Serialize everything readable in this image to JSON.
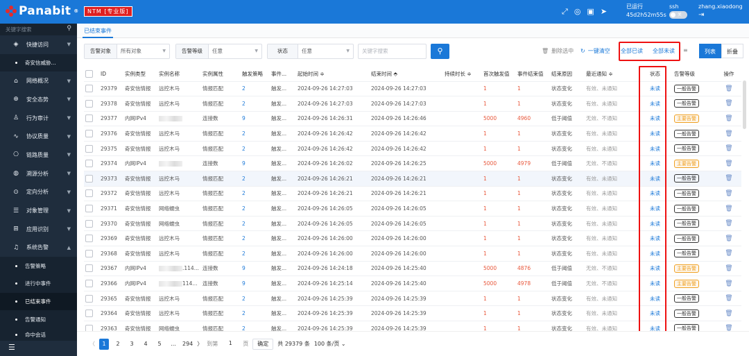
{
  "topbar": {
    "brand": "Panabit",
    "brand_reg": "®",
    "edition": "NTM [专业版]",
    "uptime_label": "已运行",
    "uptime_value": "45d2h52m55s",
    "ssh_label": "ssh",
    "toggle_text": "关",
    "user": "zhang.xiaodong",
    "logout_icon": "logout-icon"
  },
  "sidebar": {
    "search_placeholder": "关键字搜索",
    "items": [
      {
        "label": "快捷访问",
        "icon": "◈"
      },
      {
        "label": "奇安信威胁...",
        "sub": true
      },
      {
        "label": "网络概况",
        "icon": "⌂"
      },
      {
        "label": "安全态势",
        "icon": "⊕"
      },
      {
        "label": "行为审计",
        "icon": "♙"
      },
      {
        "label": "协议质量",
        "icon": "∿"
      },
      {
        "label": "链路质量",
        "icon": "⎔"
      },
      {
        "label": "溯源分析",
        "icon": "◍"
      },
      {
        "label": "定向分析",
        "icon": "⊙"
      },
      {
        "label": "对象管理",
        "icon": "☰"
      },
      {
        "label": "应用识别",
        "icon": "⊞"
      },
      {
        "label": "系统告警",
        "icon": "♫"
      }
    ],
    "subs": [
      "告警策略",
      "进行中事件",
      "已结束事件",
      "告警通知",
      "命中会话"
    ]
  },
  "tabs": {
    "current": "已结束事件"
  },
  "filters": {
    "target_label": "告警对象",
    "target_value": "所有对象",
    "level_label": "告警等级",
    "level_value": "任意",
    "status_label": "状态",
    "status_value": "任意",
    "keyword_placeholder": "关键字搜索",
    "delete_selected": "删除选中",
    "clear_all": "一键清空",
    "all_read": "全部已读",
    "all_unread": "全部未读",
    "view_list": "列表",
    "view_fold": "折叠"
  },
  "table": {
    "headers": [
      "ID",
      "实例类型",
      "实例名称",
      "实例属性",
      "触发策略",
      "事件...",
      "起始时间 ≑",
      "结束时间 ⬘",
      "持续时长 ≑",
      "首次触发值",
      "事件结束值",
      "结束原因",
      "最近通知 ≑",
      "状态",
      "告警等级",
      "操作"
    ],
    "rows": [
      [
        "29379",
        "奇安信情报",
        "远控木马",
        "情报匹配",
        "2",
        "触发...",
        "2024-09-26 14:27:03",
        "2024-09-26 14:27:03",
        "",
        "1",
        "1",
        "状态变化",
        "有效、未通知",
        "未读",
        "一般告警"
      ],
      [
        "29378",
        "奇安信情报",
        "远控木马",
        "情报匹配",
        "2",
        "触发...",
        "2024-09-26 14:27:03",
        "2024-09-26 14:27:03",
        "",
        "1",
        "1",
        "状态变化",
        "有效、未通知",
        "未读",
        "一般告警"
      ],
      [
        "29377",
        "内网IPv4",
        "",
        "连接数",
        "9",
        "触发...",
        "2024-09-26 14:26:31",
        "2024-09-26 14:26:46",
        "",
        "5000",
        "4960",
        "低于阈值",
        "无效、不通知",
        "未读",
        "主要告警"
      ],
      [
        "29376",
        "奇安信情报",
        "远控木马",
        "情报匹配",
        "2",
        "触发...",
        "2024-09-26 14:26:42",
        "2024-09-26 14:26:42",
        "",
        "1",
        "1",
        "状态变化",
        "有效、未通知",
        "未读",
        "一般告警"
      ],
      [
        "29375",
        "奇安信情报",
        "远控木马",
        "情报匹配",
        "2",
        "触发...",
        "2024-09-26 14:26:42",
        "2024-09-26 14:26:42",
        "",
        "1",
        "1",
        "状态变化",
        "有效、未通知",
        "未读",
        "一般告警"
      ],
      [
        "29374",
        "内网IPv4",
        "",
        "连接数",
        "9",
        "触发...",
        "2024-09-26 14:26:02",
        "2024-09-26 14:26:25",
        "",
        "5000",
        "4979",
        "低于阈值",
        "无效、不通知",
        "未读",
        "主要告警"
      ],
      [
        "29373",
        "奇安信情报",
        "远控木马",
        "情报匹配",
        "2",
        "触发...",
        "2024-09-26 14:26:21",
        "2024-09-26 14:26:21",
        "",
        "1",
        "1",
        "状态变化",
        "有效、未通知",
        "未读",
        "一般告警"
      ],
      [
        "29372",
        "奇安信情报",
        "远控木马",
        "情报匹配",
        "2",
        "触发...",
        "2024-09-26 14:26:21",
        "2024-09-26 14:26:21",
        "",
        "1",
        "1",
        "状态变化",
        "有效、未通知",
        "未读",
        "一般告警"
      ],
      [
        "29371",
        "奇安信情报",
        "网络蠕虫",
        "情报匹配",
        "2",
        "触发...",
        "2024-09-26 14:26:05",
        "2024-09-26 14:26:05",
        "",
        "1",
        "1",
        "状态变化",
        "有效、未通知",
        "未读",
        "一般告警"
      ],
      [
        "29370",
        "奇安信情报",
        "网络蠕虫",
        "情报匹配",
        "2",
        "触发...",
        "2024-09-26 14:26:05",
        "2024-09-26 14:26:05",
        "",
        "1",
        "1",
        "状态变化",
        "有效、未通知",
        "未读",
        "一般告警"
      ],
      [
        "29369",
        "奇安信情报",
        "远控木马",
        "情报匹配",
        "2",
        "触发...",
        "2024-09-26 14:26:00",
        "2024-09-26 14:26:00",
        "",
        "1",
        "1",
        "状态变化",
        "有效、未通知",
        "未读",
        "一般告警"
      ],
      [
        "29368",
        "奇安信情报",
        "远控木马",
        "情报匹配",
        "2",
        "触发...",
        "2024-09-26 14:26:00",
        "2024-09-26 14:26:00",
        "",
        "1",
        "1",
        "状态变化",
        "有效、未通知",
        "未读",
        "一般告警"
      ],
      [
        "29367",
        "内网IPv4",
        ".114...",
        "连接数",
        "9",
        "触发...",
        "2024-09-26 14:24:18",
        "2024-09-26 14:25:40",
        "",
        "5000",
        "4876",
        "低于阈值",
        "无效、不通知",
        "未读",
        "主要告警"
      ],
      [
        "29366",
        "内网IPv4",
        "114...",
        "连接数",
        "9",
        "触发...",
        "2024-09-26 14:25:14",
        "2024-09-26 14:25:40",
        "",
        "5000",
        "4978",
        "低于阈值",
        "无效、不通知",
        "未读",
        "主要告警"
      ],
      [
        "29365",
        "奇安信情报",
        "远控木马",
        "情报匹配",
        "2",
        "触发...",
        "2024-09-26 14:25:39",
        "2024-09-26 14:25:39",
        "",
        "1",
        "1",
        "状态变化",
        "有效、未通知",
        "未读",
        "一般告警"
      ],
      [
        "29364",
        "奇安信情报",
        "远控木马",
        "情报匹配",
        "2",
        "触发...",
        "2024-09-26 14:25:39",
        "2024-09-26 14:25:39",
        "",
        "1",
        "1",
        "状态变化",
        "有效、未通知",
        "未读",
        "一般告警"
      ],
      [
        "29363",
        "奇安信情报",
        "网络蠕虫",
        "情报匹配",
        "2",
        "触发...",
        "2024-09-26 14:25:39",
        "2024-09-26 14:25:39",
        "",
        "1",
        "1",
        "状态变化",
        "有效、未通知",
        "未读",
        "一般告警"
      ]
    ]
  },
  "pager": {
    "pages": [
      "1",
      "2",
      "3",
      "4",
      "5",
      "...",
      "294"
    ],
    "goto_label": "到第",
    "goto_value": "1",
    "page_unit": "页",
    "confirm": "确定",
    "total": "共 29379 条",
    "per_page": "100 条/页"
  },
  "colors": {
    "accent": "#1a78d8",
    "sidebar": "#1f2d3d",
    "highlight_box": "#e11111",
    "warn_tag": "#f0a020"
  }
}
